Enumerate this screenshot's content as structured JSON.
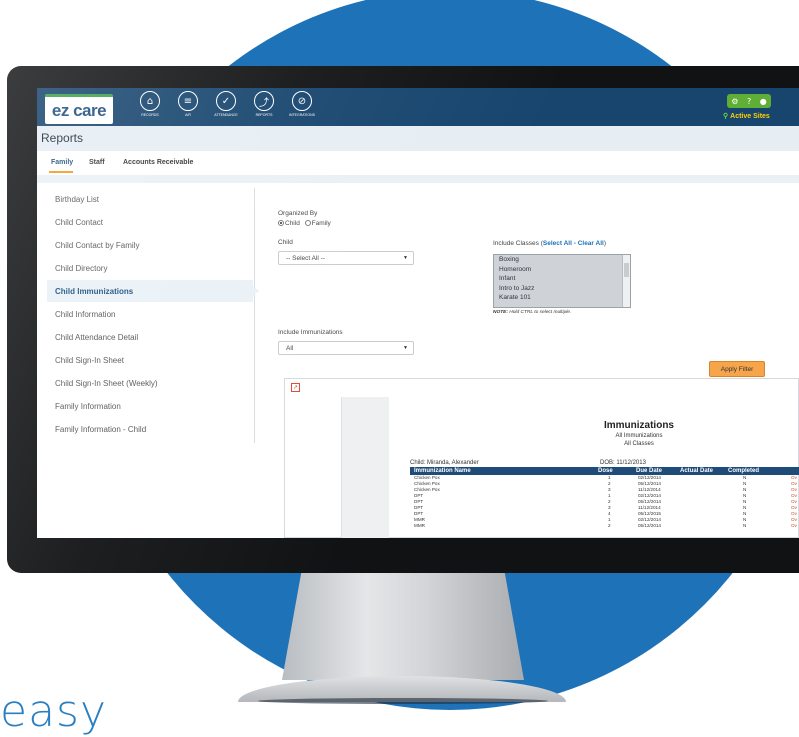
{
  "tagline": "easy",
  "app": {
    "logo_text": "ez care",
    "nav": [
      {
        "label": "RECORDS",
        "icon": "home-icon"
      },
      {
        "label": "A/R",
        "icon": "list-icon"
      },
      {
        "label": "ATTENDANCE",
        "icon": "checklist-icon"
      },
      {
        "label": "REPORTS",
        "icon": "chart-icon"
      },
      {
        "label": "INTEGRATIONS",
        "icon": "link-icon"
      }
    ],
    "util_icons": [
      "gear-icon",
      "help-icon",
      "user-icon"
    ],
    "active_sites": "Active Sites",
    "accent_color": "#17456e",
    "brand_green": "#5fae35"
  },
  "page": {
    "title": "Reports",
    "tabs": [
      "Family",
      "Staff",
      "Accounts Receivable"
    ],
    "active_tab": "Family"
  },
  "sidebar": {
    "items": [
      "Birthday List",
      "Child Contact",
      "Child Contact by Family",
      "Child Directory",
      "Child Immunizations",
      "Child Information",
      "Child Attendance Detail",
      "Child Sign-In Sheet",
      "Child Sign-In Sheet (Weekly)",
      "Family Information",
      "Family Information - Child"
    ],
    "active_item": "Child Immunizations"
  },
  "filters": {
    "organized_by_label": "Organized By",
    "organized_options": [
      "Child",
      "Family"
    ],
    "organized_selected": "Child",
    "child_label": "Child",
    "child_value": "-- Select All --",
    "include_classes_label": "Include Classes",
    "select_all": "Select All",
    "clear_all": "Clear All",
    "classes": [
      "Boxing",
      "Homeroom",
      "Infant",
      "Intro to Jazz",
      "Karate 101"
    ],
    "note_bold": "NOTE:",
    "note_text": "Hold CTRL to select multiple.",
    "include_immunizations_label": "Include Immunizations",
    "immunizations_value": "All",
    "apply_label": "Apply Filter"
  },
  "report": {
    "title": "Immunizations",
    "subtitle1": "All Immunizations",
    "subtitle2": "All Classes",
    "child_text": "Child: Miranda, Alexander",
    "dob_text": "DOB: 11/12/2013",
    "columns": [
      "Immunization Name",
      "Dose",
      "Due Date",
      "Actual Date",
      "Completed"
    ],
    "rows": [
      {
        "name": "Chicken Pox",
        "dose": "1",
        "due": "02/12/2014",
        "completed": "N",
        "flag": "Ov"
      },
      {
        "name": "Chicken Pox",
        "dose": "2",
        "due": "05/12/2014",
        "completed": "N",
        "flag": "Ov"
      },
      {
        "name": "Chicken Pox",
        "dose": "3",
        "due": "11/12/2014",
        "completed": "N",
        "flag": "Ov"
      },
      {
        "name": "DPT",
        "dose": "1",
        "due": "02/12/2014",
        "completed": "N",
        "flag": "Ov"
      },
      {
        "name": "DPT",
        "dose": "2",
        "due": "05/12/2014",
        "completed": "N",
        "flag": "Ov"
      },
      {
        "name": "DPT",
        "dose": "3",
        "due": "11/12/2014",
        "completed": "N",
        "flag": "Ov"
      },
      {
        "name": "DPT",
        "dose": "4",
        "due": "05/12/2015",
        "completed": "N",
        "flag": "Ov"
      },
      {
        "name": "MMR",
        "dose": "1",
        "due": "02/12/2014",
        "completed": "N",
        "flag": "Ov"
      },
      {
        "name": "MMR",
        "dose": "2",
        "due": "05/12/2014",
        "completed": "N",
        "flag": "Ov"
      }
    ]
  }
}
